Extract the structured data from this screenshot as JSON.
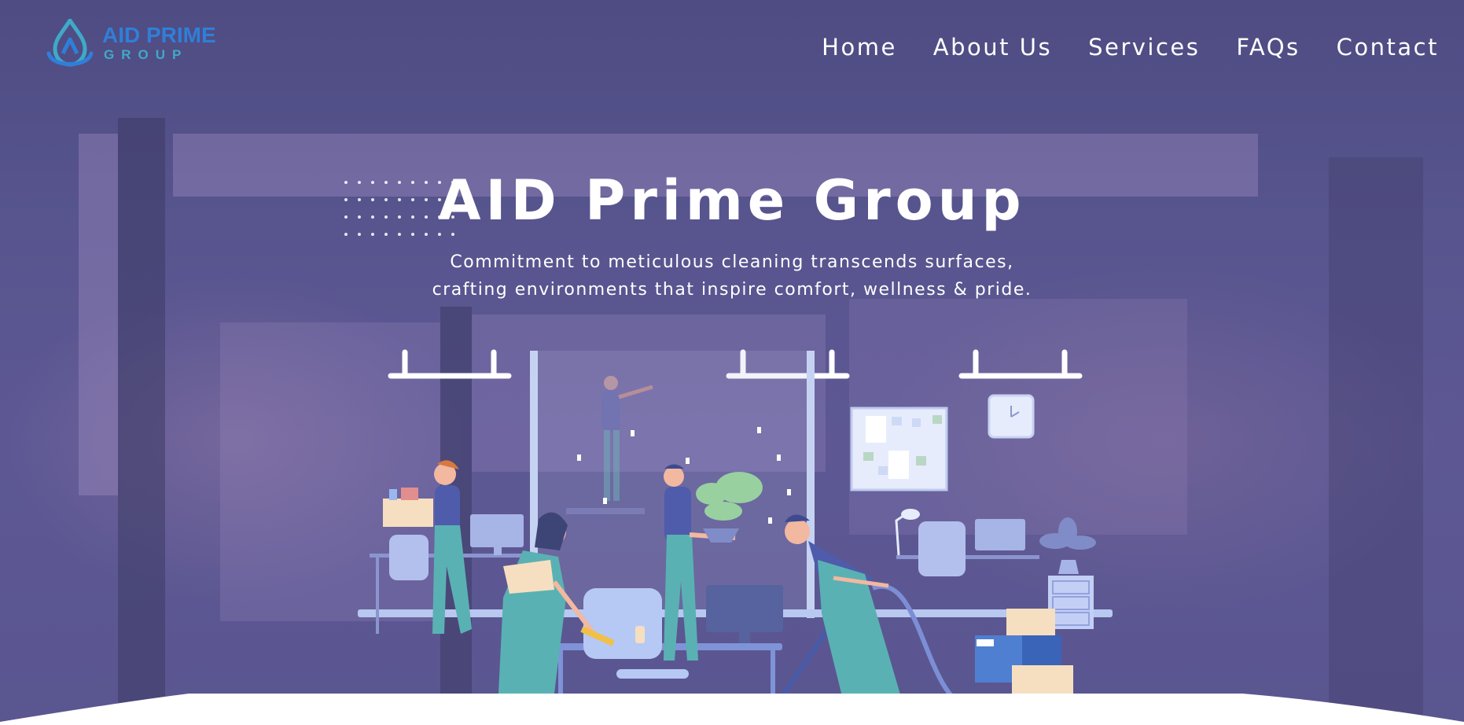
{
  "brand": {
    "name_line1": "AID PRIME",
    "name_line2": "GROUP",
    "logo_icon": "water-drop-logo-icon",
    "primary_color": "#2f7fd8",
    "secondary_color": "#3fa9c9"
  },
  "nav": {
    "items": [
      {
        "label": "Home"
      },
      {
        "label": "About Us"
      },
      {
        "label": "Services"
      },
      {
        "label": "FAQs"
      },
      {
        "label": "Contact"
      }
    ]
  },
  "hero": {
    "title": "AID Prime Group",
    "tagline_line1": "Commitment to meticulous cleaning transcends surfaces,",
    "tagline_line2": "crafting environments that inspire comfort, wellness & pride.",
    "overlay_color": "#4e4c85",
    "illustration": "office-cleaning-team-illustration"
  }
}
